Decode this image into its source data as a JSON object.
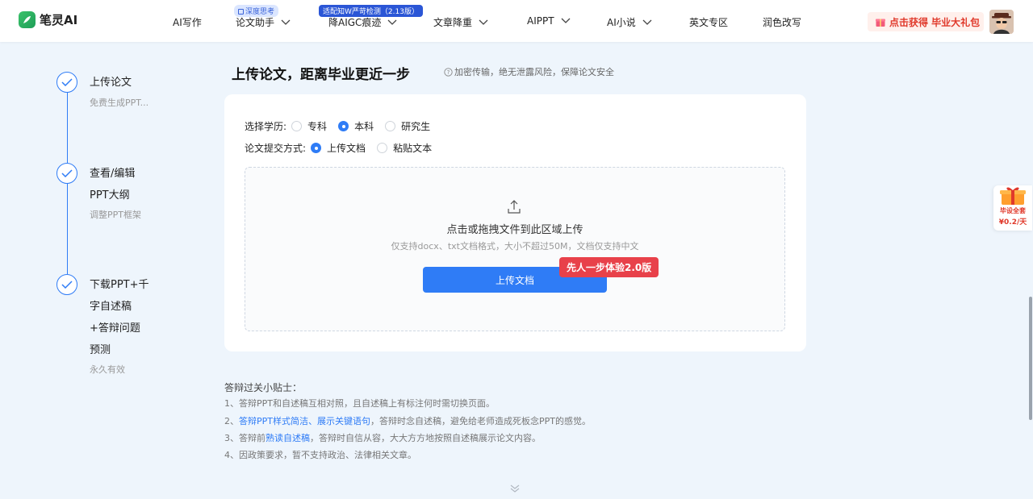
{
  "header": {
    "logo_text": "笔灵AI",
    "nav": [
      {
        "label": "AI写作"
      },
      {
        "label": "论文助手",
        "badge": "深度思考"
      },
      {
        "label": "降AIGC痕迹",
        "badge": "适配知W严苛检测（2.13版）"
      },
      {
        "label": "文章降重"
      },
      {
        "label": "AIPPT"
      },
      {
        "label": "AI小说"
      },
      {
        "label": "英文专区"
      },
      {
        "label": "润色改写"
      }
    ],
    "promo": "点击获得 毕业大礼包"
  },
  "steps": [
    {
      "title": "上传论文",
      "sub": "免费生成PPT..."
    },
    {
      "title_lines": [
        "查看/编辑",
        "PPT大纲"
      ],
      "sub": "调整PPT框架"
    },
    {
      "title_lines": [
        "下载PPT+千",
        "字自述稿",
        "+答辩问题",
        "预测"
      ],
      "sub": "永久有效"
    }
  ],
  "main": {
    "title": "上传论文，距离毕业更近一步",
    "note": "加密传输，绝无泄露风险，保障论文安全",
    "education": {
      "label": "选择学历:",
      "options": [
        {
          "label": "专科",
          "selected": false
        },
        {
          "label": "本科",
          "selected": true
        },
        {
          "label": "研究生",
          "selected": false
        }
      ]
    },
    "submit": {
      "label": "论文提交方式:",
      "options": [
        {
          "label": "上传文档",
          "selected": true
        },
        {
          "label": "粘贴文本",
          "selected": false
        }
      ]
    },
    "dropzone": {
      "title": "点击或拖拽文件到此区域上传",
      "sub": "仅支持docx、txt文档格式，大小不超过50M，文档仅支持中文",
      "button": "上传文档",
      "badge": "先人一步体验2.0版"
    }
  },
  "tips": {
    "title": "答辩过关小贴士：",
    "items": [
      {
        "prefix": "1、答辩PPT和自述稿互相对照，且自述稿上有标注何时需切换页面。"
      },
      {
        "prefix": "2、",
        "highlight": "答辩PPT样式简洁、展示关键语句",
        "suffix": "，答辩时念自述稿，避免给老师造成死板念PPT的感觉。"
      },
      {
        "prefix": "3、答辩前",
        "highlight": "熟读自述稿",
        "suffix": "，答辩时自信从容，大大方方地按照自述稿展示论文内容。"
      },
      {
        "prefix": "4、因政策要求，暂不支持政治、法律相关文章。"
      }
    ]
  },
  "float_gift": {
    "line1": "毕设全套",
    "line2": "¥0.2/天"
  },
  "colors": {
    "accent": "#2f7cf6",
    "badge_red": "#e8414a",
    "promo_red": "#e0392b",
    "background": "#eef5fc"
  }
}
